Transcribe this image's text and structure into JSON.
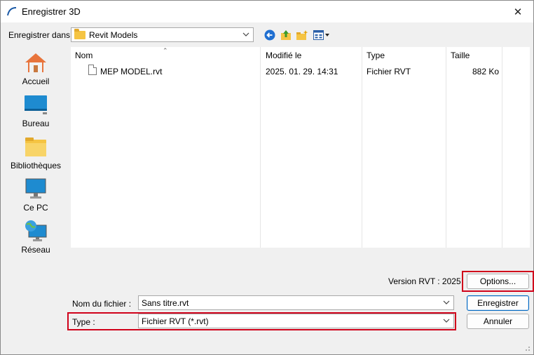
{
  "window": {
    "title": "Enregistrer 3D"
  },
  "toolbar": {
    "save_in_label": "Enregistrer dans :",
    "save_in_value": "Revit Models",
    "back_icon": "back-arrow-icon",
    "up_icon": "up-folder-icon",
    "new_folder_icon": "new-folder-icon",
    "view_menu_icon": "view-menu-icon"
  },
  "places": [
    {
      "label": "Accueil",
      "icon": "home-icon"
    },
    {
      "label": "Bureau",
      "icon": "desktop-icon"
    },
    {
      "label": "Bibliothèques",
      "icon": "libraries-icon"
    },
    {
      "label": "Ce PC",
      "icon": "computer-icon"
    },
    {
      "label": "Réseau",
      "icon": "network-icon"
    }
  ],
  "filelist": {
    "columns": [
      "Nom",
      "Modifié le",
      "Type",
      "Taille"
    ],
    "rows": [
      {
        "name": "MEP MODEL.rvt",
        "modified": "2025. 01. 29. 14:31",
        "type": "Fichier RVT",
        "size": "882 Ko"
      }
    ]
  },
  "footer": {
    "version_label": "Version RVT : 2025",
    "options_button": "Options...",
    "filename_label": "Nom du fichier :",
    "filename_value": "Sans titre.rvt",
    "type_label": "Type :",
    "type_value": "Fichier RVT (*.rvt)",
    "save_button": "Enregistrer",
    "cancel_button": "Annuler"
  },
  "colors": {
    "highlight_box": "#d0021b",
    "primary_border": "#0067c0",
    "folder": "#f5c443"
  }
}
